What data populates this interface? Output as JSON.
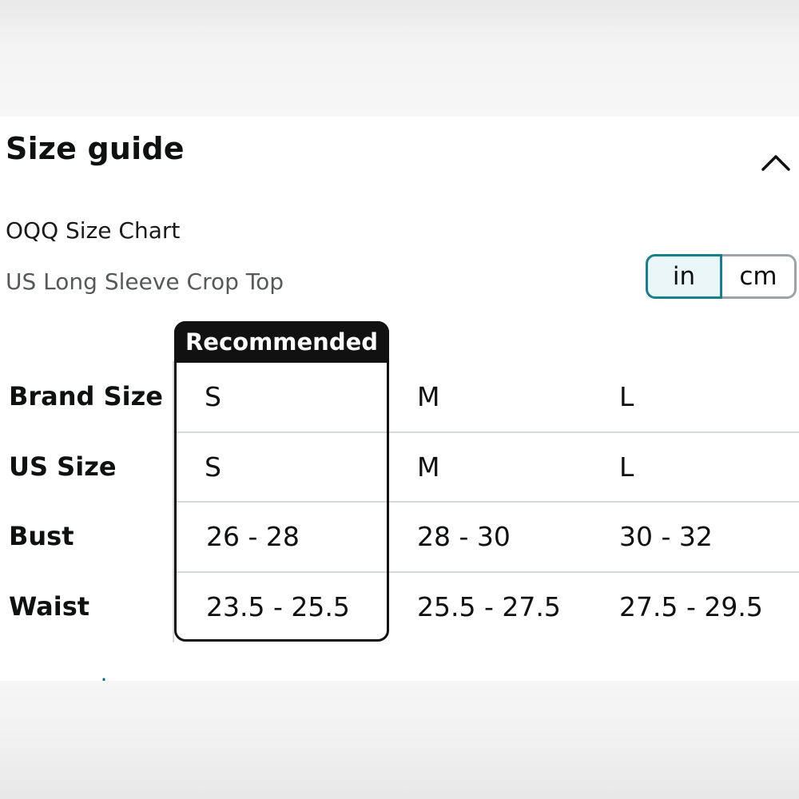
{
  "size_guide": {
    "title": "Size guide",
    "brand_chart": "OQQ Size Chart",
    "chart_type": "US Long Sleeve Crop Top",
    "units": {
      "options": [
        "in",
        "cm"
      ],
      "selected": "in"
    },
    "recommended_label": "Recommended",
    "rows": [
      {
        "label": "Brand Size",
        "values": [
          "S",
          "M",
          "L"
        ]
      },
      {
        "label": "US Size",
        "values": [
          "S",
          "M",
          "L"
        ]
      },
      {
        "label": "Bust",
        "values": [
          "26 - 28",
          "28 - 30",
          "30 - 32"
        ]
      },
      {
        "label": "Waist",
        "values": [
          "23.5 - 25.5",
          "25.5 - 27.5",
          "27.5 - 29.5"
        ]
      }
    ]
  },
  "colors": {
    "selected_unit_border": "#1a7f8c",
    "selected_unit_bg": "#eaf6f8",
    "recommended_bg": "#111111",
    "link": "#007185"
  },
  "icons": {
    "collapse": "chevron-up-icon"
  }
}
